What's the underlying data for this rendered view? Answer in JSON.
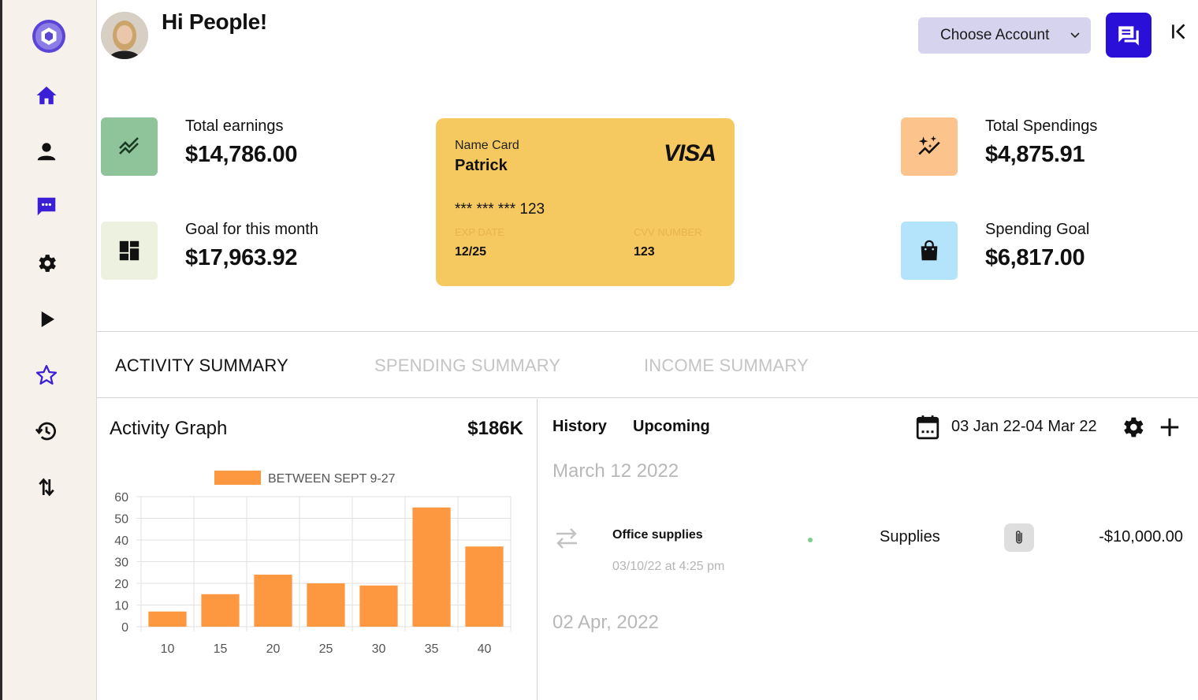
{
  "header": {
    "greeting": "Hi People!",
    "account_select": "Choose Account"
  },
  "stats": {
    "total_earnings": {
      "label": "Total earnings",
      "value": "$14,786.00",
      "color": "#8fc49a"
    },
    "goal_month": {
      "label": "Goal for this month",
      "value": "$17,963.92",
      "color": "#edf1df"
    },
    "total_spendings": {
      "label": "Total Spendings",
      "value": "$4,875.91",
      "color": "#fcc38d"
    },
    "spending_goal": {
      "label": "Spending Goal",
      "value": "$6,817.00",
      "color": "#b4e4fb"
    }
  },
  "card": {
    "label": "Name Card",
    "name": "Patrick",
    "brand": "VISA",
    "number": "*** *** *** 123",
    "exp_label": "EXP DATE",
    "exp": "12/25",
    "cvv_label": "CVV NUMBER",
    "cvv": "123",
    "color": "#f6c860"
  },
  "tabs": [
    {
      "label": "ACTIVITY SUMMARY",
      "active": true
    },
    {
      "label": "SPENDING SUMMARY",
      "active": false
    },
    {
      "label": "INCOME SUMMARY",
      "active": false
    }
  ],
  "activity": {
    "title": "Activity Graph",
    "total": "$186K"
  },
  "chart_data": {
    "type": "bar",
    "categories": [
      "10",
      "15",
      "20",
      "25",
      "30",
      "35",
      "40"
    ],
    "series": [
      {
        "name": "BETWEEN SEPT 9-27",
        "values": [
          7,
          15,
          24,
          20,
          19,
          55,
          37
        ],
        "color": "#fd9840"
      }
    ],
    "ylim": [
      0,
      60
    ],
    "yticks": [
      0,
      10,
      20,
      30,
      40,
      50,
      60
    ],
    "grid": true,
    "legend": "top-center"
  },
  "history": {
    "tab_history": "History",
    "tab_upcoming": "Upcoming",
    "date_range": "03 Jan 22-04 Mar 22",
    "groups": [
      {
        "date": "March 12 2022"
      },
      {
        "date": "02 Apr, 2022"
      }
    ],
    "transaction": {
      "name": "Office supplies",
      "time": "03/10/22 at 4:25 pm",
      "category": "Supplies",
      "amount": "-$10,000.00"
    }
  },
  "sidebar": {
    "accent": "#3b1fd6",
    "items": [
      "logo-icon",
      "home-icon",
      "person-icon",
      "chat-icon",
      "gear-icon",
      "play-icon",
      "star-icon",
      "history-icon",
      "swap-icon"
    ]
  }
}
